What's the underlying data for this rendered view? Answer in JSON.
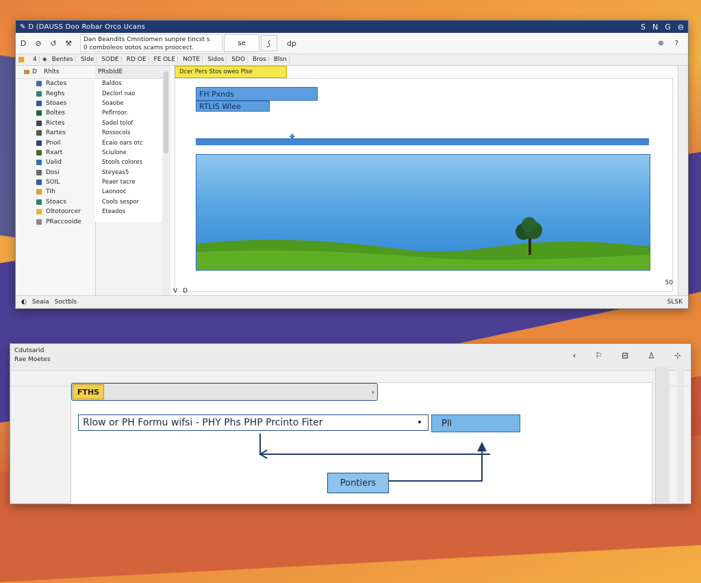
{
  "colors": {
    "titlebar": "#1f3a6e",
    "accent_blue": "#5b9ee0",
    "highlight_yellow": "#f6e84b",
    "grass": "#4e9a1f",
    "sky": "#56a4e2"
  },
  "top_window": {
    "title": "D (DAUSS  Doo Robar Orco Ucans",
    "title_icon": "pencil-icon",
    "controls": [
      "S",
      "N",
      "G",
      "⊖"
    ],
    "ribbon": {
      "info_line1": "Dan Beandits Cmntiomen sunpre tincst s",
      "info_line2": "0 comboleos ootos scams proocect.",
      "search_label": "se",
      "right_icons": [
        "dp",
        "?"
      ]
    },
    "toolbar_tabs": [
      "D",
      "4",
      "Bentes",
      "Slde",
      "SODE",
      "RD OE",
      "FE  OLE",
      "NOTE",
      "Sidos",
      "SDO",
      "Bros",
      "Blsn"
    ],
    "sidebar": {
      "header": [
        "D",
        "Rhlts"
      ],
      "items": [
        {
          "label": "Ractes",
          "icon_color": "#3b6fc0"
        },
        {
          "label": "Reghs",
          "icon_color": "#1f8a7a"
        },
        {
          "label": "Stoaes",
          "icon_color": "#2a5fa8"
        },
        {
          "label": "Boltes",
          "icon_color": "#1f6a3a"
        },
        {
          "label": "Rictes",
          "icon_color": "#444444"
        },
        {
          "label": "Rartes",
          "icon_color": "#555555"
        },
        {
          "label": "Pnoil",
          "icon_color": "#2a3f90"
        },
        {
          "label": "Rxart",
          "icon_color": "#4a6a2a"
        },
        {
          "label": "Ualid",
          "icon_color": "#2a6fc0"
        },
        {
          "label": "Dosi",
          "icon_color": "#6a6a6a"
        },
        {
          "label": "SOIL",
          "icon_color": "#2a5fa8"
        },
        {
          "label": "TIh",
          "icon_color": "#d8a528"
        },
        {
          "label": "Stoacs",
          "icon_color": "#2a8a6a"
        },
        {
          "label": "Oltotoorcer",
          "icon_color": "#e5b42a"
        },
        {
          "label": "PRaccooide",
          "icon_color": "#888888"
        }
      ]
    },
    "files": {
      "header": "PRsbIdE",
      "items": [
        "Baldos",
        "Declorl nao",
        "Soaobe",
        "Peflrroor.",
        "Sadel tolof",
        "Rossocols",
        "Ecaio oars otc",
        "Sciulone",
        "Stools colores",
        "Steyeas5",
        "Peaer tacre",
        "Laonooc",
        "Cools sespor",
        "Eteados"
      ]
    },
    "canvas": {
      "tag": "Dcer Pers Stos oweo Plse",
      "label_1": "FH Pxnds",
      "label_2": "RTLIS Wlee",
      "footer": [
        "V",
        "D"
      ],
      "page_num": "50"
    },
    "statusbar": {
      "left": [
        "Seaia",
        "Soctbls"
      ],
      "right": "SLSK"
    }
  },
  "bottom_window": {
    "title_line1": "Cdutsarid",
    "title_line2": "Rae  Moetes",
    "icons": [
      "‹",
      "⚐",
      "⊟",
      "♙",
      "⊹"
    ],
    "subbar_icon": "ly",
    "path_tag": "FTHS",
    "expression": "Rlow or PH Formu wifsi - PHY Phs PHP Prcinto Fiter",
    "expr_result": "Pli",
    "result_box": "Pontiers"
  }
}
